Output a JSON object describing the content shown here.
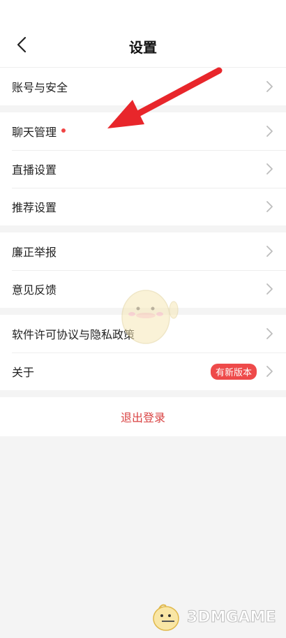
{
  "header": {
    "title": "设置",
    "back_icon": "chevron-left-icon"
  },
  "groups": [
    {
      "items": [
        {
          "label": "账号与安全"
        }
      ]
    },
    {
      "items": [
        {
          "label": "聊天管理",
          "dot": true
        },
        {
          "label": "直播设置"
        },
        {
          "label": "推荐设置"
        }
      ]
    },
    {
      "items": [
        {
          "label": "廉正举报"
        },
        {
          "label": "意见反馈"
        }
      ]
    },
    {
      "items": [
        {
          "label": "软件许可协议与隐私政策"
        },
        {
          "label": "关于",
          "badge": "有新版本"
        }
      ]
    }
  ],
  "logout": {
    "label": "退出登录"
  },
  "watermark": {
    "text": "3DMGAME"
  },
  "colors": {
    "accent_red": "#ee4a4a",
    "logout_text": "#d94343",
    "background": "#f4f4f4"
  }
}
